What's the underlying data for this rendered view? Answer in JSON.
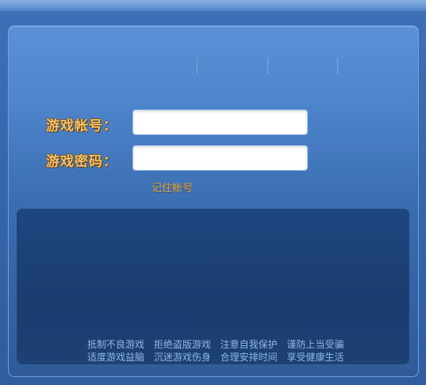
{
  "login": {
    "account_label": "游戏帐号：",
    "account_value": "",
    "password_label": "游戏密码：",
    "password_value": "",
    "remember_label": "记住帐号"
  },
  "notice": {
    "line1": "抵制不良游戏 拒绝盗版游戏 注意自我保护 谨防上当受骗",
    "line2": "适度游戏益脑 沉迷游戏伤身 合理安排时间 享受健康生活"
  },
  "colors": {
    "label": "#f3c26a",
    "remember": "#e8a830",
    "notice_text": "#8fb7e6",
    "panel": "#4e86cc",
    "notice_bg": "#1a3d70"
  }
}
